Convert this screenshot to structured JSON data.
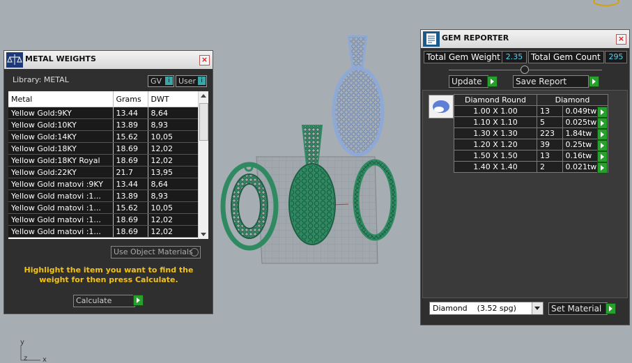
{
  "metal_weights": {
    "title": "METAL WEIGHTS",
    "library_label": "Library: METAL",
    "gv_label": "GV",
    "user_label": "User",
    "columns": [
      "Metal",
      "Grams",
      "DWT"
    ],
    "rows": [
      {
        "metal": "Yellow Gold:9KY",
        "grams": "13.44",
        "dwt": "8,64"
      },
      {
        "metal": "Yellow Gold:10KY",
        "grams": "13.89",
        "dwt": "8,93"
      },
      {
        "metal": "Yellow Gold:14KY",
        "grams": "15.62",
        "dwt": "10,05"
      },
      {
        "metal": "Yellow Gold:18KY",
        "grams": "18.69",
        "dwt": "12,02"
      },
      {
        "metal": "Yellow Gold:18KY Royal",
        "grams": "18.69",
        "dwt": "12,02"
      },
      {
        "metal": "Yellow Gold:22KY",
        "grams": "21.7",
        "dwt": "13,95"
      },
      {
        "metal": "Yellow Gold matovi :9KY",
        "grams": "13.44",
        "dwt": "8,64"
      },
      {
        "metal": "Yellow Gold matovi :1...",
        "grams": "13.89",
        "dwt": "8,93"
      },
      {
        "metal": "Yellow Gold matovi :1...",
        "grams": "15.62",
        "dwt": "10,05"
      },
      {
        "metal": "Yellow Gold matovi :1...",
        "grams": "18.69",
        "dwt": "12,02"
      },
      {
        "metal": "Yellow Gold matovi :1...",
        "grams": "18.69",
        "dwt": "12,02"
      }
    ],
    "use_object_materials_label": "Use Object Materials",
    "instruction": "Highlight the item you want to find the weight for then press Calculate.",
    "calculate_label": "Calculate"
  },
  "gem_reporter": {
    "title": "GEM REPORTER",
    "total_gem_weight_label": "Total Gem Weight",
    "total_gem_weight_value": "2.35",
    "total_gem_count_label": "Total Gem Count",
    "total_gem_count_value": "295",
    "update_label": "Update",
    "save_report_label": "Save Report",
    "columns": [
      "Diamond Round",
      "Diamond"
    ],
    "rows": [
      {
        "size": "1.00 X 1.00",
        "count": "13",
        "weight": "0.049tw"
      },
      {
        "size": "1.10 X 1.10",
        "count": "5",
        "weight": "0.025tw"
      },
      {
        "size": "1.30 X 1.30",
        "count": "223",
        "weight": "1.84tw"
      },
      {
        "size": "1.20 X 1.20",
        "count": "39",
        "weight": "0.25tw"
      },
      {
        "size": "1.50 X 1.50",
        "count": "13",
        "weight": "0.16tw"
      },
      {
        "size": "1.40 X 1.40",
        "count": "2",
        "weight": "0.021tw"
      }
    ],
    "material_select": "Diamond    (3.52 spg)",
    "set_material_label": "Set Material"
  },
  "viewport": {
    "axis_y": "y",
    "axis_z": "z",
    "axis_x": "x"
  },
  "colors": {
    "viewport_bg": "#a6adb3",
    "model_green": "#2f8a62",
    "model_blue": "#8fa9d6",
    "instruction_text": "#f2c21b",
    "accent_green": "#27a02c"
  }
}
